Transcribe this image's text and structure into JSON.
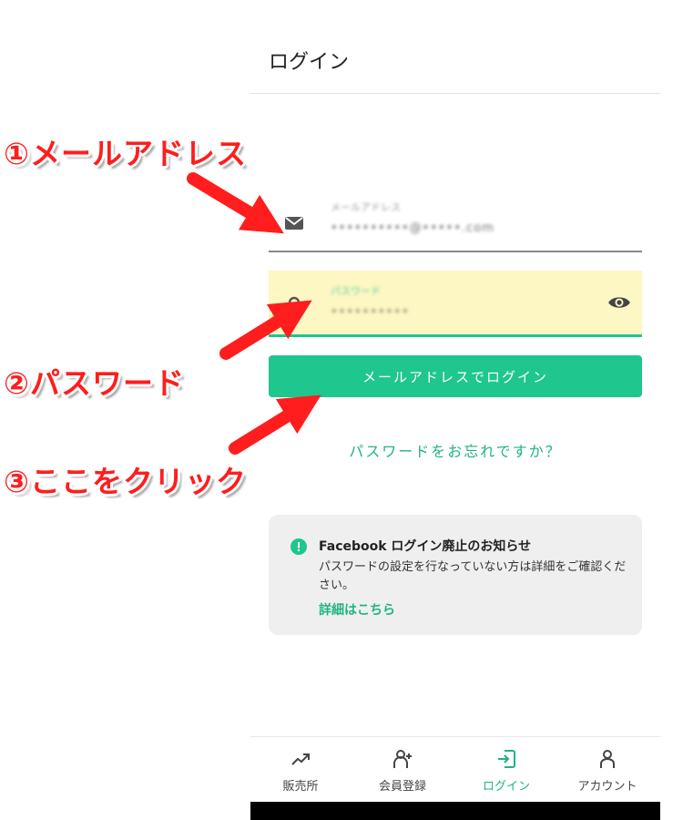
{
  "header": {
    "title": "ログイン"
  },
  "email": {
    "label": "メールアドレス",
    "value": "••••••••••@•••••.com"
  },
  "password": {
    "label": "パスワード",
    "value": "••••••••••"
  },
  "login_button": {
    "label": "メールアドレスでログイン"
  },
  "forgot_link": {
    "label": "パスワードをお忘れですか？"
  },
  "notice": {
    "title": "Facebook ログイン廃止のお知らせ",
    "body": "パスワードの設定を行なっていない方は詳細をご確認ください。",
    "link": "詳細はこちら"
  },
  "nav": {
    "items": [
      {
        "label": "販売所",
        "icon": "trend-up-icon"
      },
      {
        "label": "会員登録",
        "icon": "user-add-icon"
      },
      {
        "label": "ログイン",
        "icon": "login-icon",
        "active": true
      },
      {
        "label": "アカウント",
        "icon": "user-icon"
      }
    ]
  },
  "annotations": {
    "step1": "①メールアドレス",
    "step2": "②パスワード",
    "step3": "③ここをクリック"
  },
  "colors": {
    "accent": "#1fc68e",
    "link": "#1fb384",
    "annotation": "#ff1d1d"
  }
}
